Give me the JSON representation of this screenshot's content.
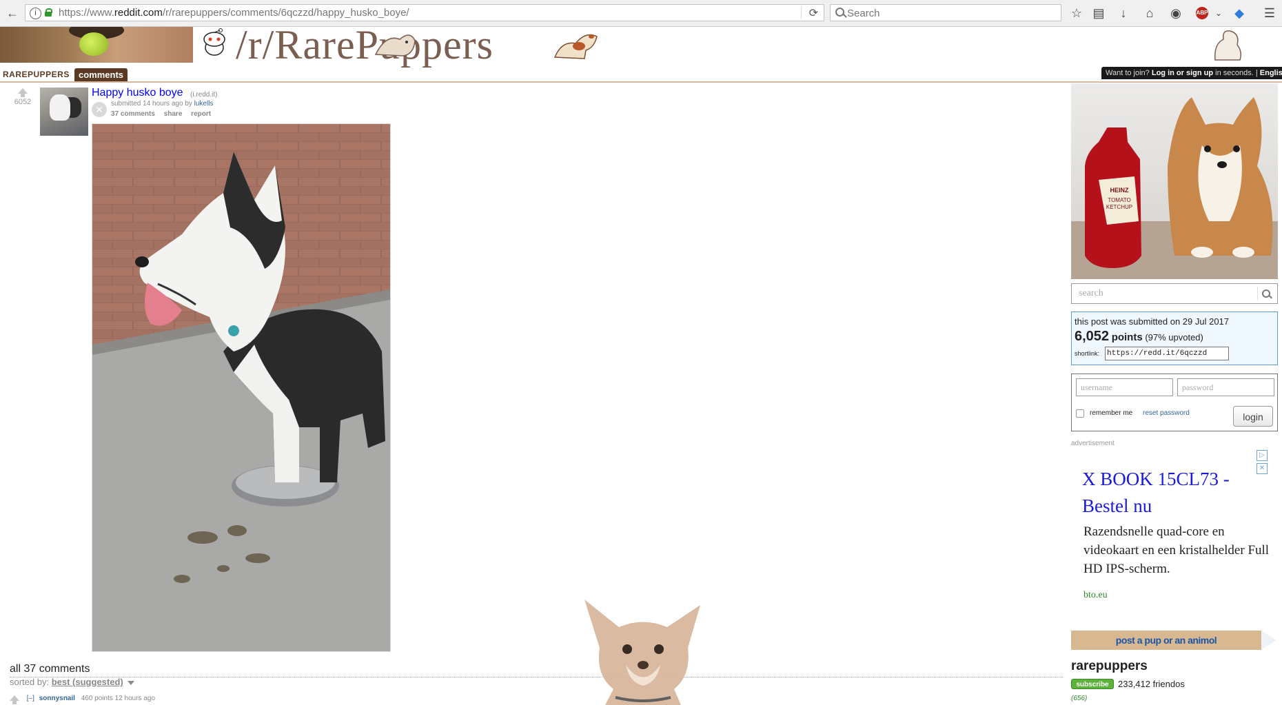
{
  "browser": {
    "url_prefix": "https://www.",
    "url_host": "reddit.com",
    "url_path": "/r/rarepuppers/comments/6qczzd/happy_husko_boye/",
    "search_placeholder": "Search",
    "adblock_label": "ABP"
  },
  "header": {
    "subreddit_title": "/r/RarePuppers",
    "tab_subreddit": "RAREPUPPERS",
    "tab_comments": "comments",
    "join_prefix": "Want to join?",
    "join_link": "Log in or sign up",
    "join_suffix": "in seconds.",
    "join_sep": "|",
    "language": "English"
  },
  "post": {
    "score": "6052",
    "title": "Happy husko boye",
    "domain": "(i.redd.it)",
    "submitted": "submitted 14 hours ago by",
    "author": "lukells",
    "comments_link": "37 comments",
    "share": "share",
    "report": "report"
  },
  "comments": {
    "heading": "all 37 comments",
    "sorted_label": "sorted by:",
    "sort_value": "best (suggested)",
    "first": {
      "toggle": "[–]",
      "author": "sonnysnail",
      "meta": "460 points 12 hours ago"
    }
  },
  "sidebar": {
    "search_placeholder": "search",
    "info": {
      "submitted_on": "this post was submitted on 29 Jul 2017",
      "points": "6,052",
      "points_label": "points",
      "upvoted": "(97% upvoted)",
      "shortlink_label": "shortlink:",
      "shortlink": "https://redd.it/6qczzd"
    },
    "login": {
      "username_placeholder": "username",
      "password_placeholder": "password",
      "remember": "remember me",
      "reset": "reset password",
      "button": "login"
    },
    "ad": {
      "label": "advertisement",
      "headline": "X BOOK 15CL73 - Bestel nu",
      "body": "Razendsnelle quad-core en videokaart en een kristalhelder Full HD IPS-scherm.",
      "url": "bto.eu"
    },
    "submit_button": "post a pup or an animol",
    "subreddit_name": "rarepuppers",
    "subscribe": "subscribe",
    "subscribers": "233,412 friendos",
    "online": "(656)"
  },
  "colors": {
    "link_blue": "#0000ff",
    "header_brown": "#5a3a22",
    "info_border": "#5f99cf",
    "subscribe_green": "#5cb23a"
  }
}
